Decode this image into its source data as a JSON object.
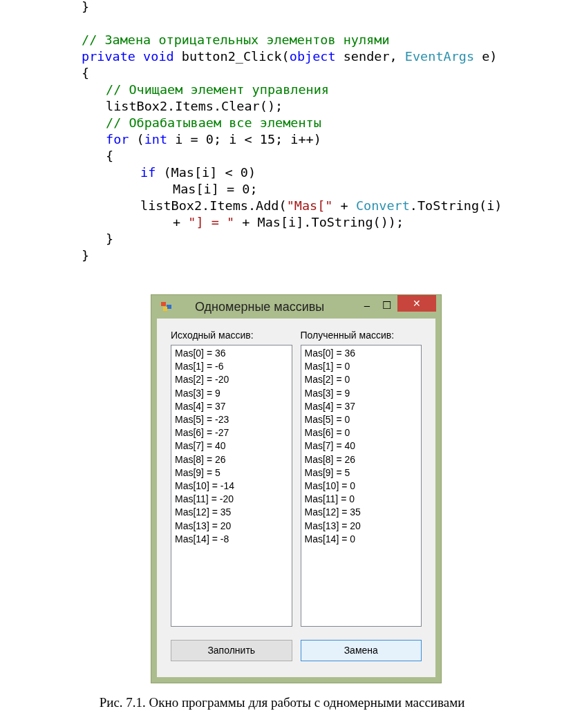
{
  "code": {
    "lines": [
      {
        "kind": "code",
        "tokens": [
          {
            "kind": "plain",
            "text": "}"
          }
        ]
      },
      {
        "kind": "blank"
      },
      {
        "kind": "code",
        "tokens": [
          {
            "kind": "comment",
            "text": "// Замена отрицательных элементов нулями"
          }
        ]
      },
      {
        "kind": "code",
        "tokens": [
          {
            "kind": "keyword",
            "text": "private"
          },
          {
            "kind": "keyword",
            "text": " void"
          },
          {
            "kind": "plain",
            "text": " button2_Click("
          },
          {
            "kind": "keyword",
            "text": "object"
          },
          {
            "kind": "plain",
            "text": " sender, "
          },
          {
            "kind": "type",
            "text": "EventArgs"
          },
          {
            "kind": "plain",
            "text": " e)"
          }
        ]
      },
      {
        "kind": "code",
        "tokens": [
          {
            "kind": "plain",
            "text": "{"
          }
        ],
        "children": [
          {
            "kind": "code",
            "tokens": [
              {
                "kind": "comment",
                "text": "// Очищаем элемент управления"
              }
            ]
          },
          {
            "kind": "code",
            "tokens": [
              {
                "kind": "plain",
                "text": "listBox2.Items.Clear();"
              }
            ]
          },
          {
            "kind": "code",
            "tokens": [
              {
                "kind": "comment",
                "text": "// Обрабатываем все элементы"
              }
            ]
          },
          {
            "kind": "code",
            "tokens": [
              {
                "kind": "keyword",
                "text": "for"
              },
              {
                "kind": "plain",
                "text": " ("
              },
              {
                "kind": "keyword",
                "text": "int"
              },
              {
                "kind": "plain",
                "text": " i = 0; i < 15; i++)"
              }
            ]
          },
          {
            "kind": "code",
            "tokens": [
              {
                "kind": "plain",
                "text": "{"
              }
            ],
            "children": [
              {
                "kind": "code",
                "tokens": [
                  {
                    "kind": "keyword",
                    "text": "if"
                  },
                  {
                    "kind": "plain",
                    "text": " (Mas[i] < 0)"
                  }
                ],
                "children": [
                  {
                    "kind": "code",
                    "tokens": [
                      {
                        "kind": "plain",
                        "text": "Mas[i] = 0;"
                      }
                    ]
                  }
                ]
              },
              {
                "kind": "code",
                "tokens": [
                  {
                    "kind": "plain",
                    "text": "listBox2.Items.Add("
                  },
                  {
                    "kind": "string",
                    "text": "\"Mas[\""
                  },
                  {
                    "kind": "plain",
                    "text": " + "
                  },
                  {
                    "kind": "type",
                    "text": "Convert"
                  },
                  {
                    "kind": "plain",
                    "text": ".ToString(i)"
                  }
                ],
                "children": [
                  {
                    "kind": "code",
                    "tokens": [
                      {
                        "kind": "plain",
                        "text": "+ "
                      },
                      {
                        "kind": "string",
                        "text": "\"] = \""
                      },
                      {
                        "kind": "plain",
                        "text": " + Mas[i].ToString());"
                      }
                    ]
                  }
                ]
              }
            ]
          },
          {
            "kind": "code",
            "tokens": [
              {
                "kind": "plain",
                "text": "}"
              }
            ]
          }
        ]
      },
      {
        "kind": "code",
        "tokens": [
          {
            "kind": "plain",
            "text": "}"
          }
        ]
      }
    ]
  },
  "window": {
    "title": "Одномерные массивы",
    "minimize": "–",
    "maximize": "☐",
    "close": "✕",
    "lists": [
      {
        "label": "Исходный массив:",
        "items": [
          "Mas[0] = 36",
          "Mas[1] = -6",
          "Mas[2] = -20",
          "Mas[3] = 9",
          "Mas[4] = 37",
          "Mas[5] = -23",
          "Mas[6] = -27",
          "Mas[7] = 40",
          "Mas[8] = 26",
          "Mas[9] = 5",
          "Mas[10] = -14",
          "Mas[11] = -20",
          "Mas[12] = 35",
          "Mas[13] = 20",
          "Mas[14] = -8"
        ]
      },
      {
        "label": "Полученный массив:",
        "items": [
          "Mas[0] = 36",
          "Mas[1] = 0",
          "Mas[2] = 0",
          "Mas[3] = 9",
          "Mas[4] = 37",
          "Mas[5] = 0",
          "Mas[6] = 0",
          "Mas[7] = 40",
          "Mas[8] = 26",
          "Mas[9] = 5",
          "Mas[10] = 0",
          "Mas[11] = 0",
          "Mas[12] = 35",
          "Mas[13] = 20",
          "Mas[14] = 0"
        ]
      }
    ],
    "buttons": [
      {
        "label": "Заполнить",
        "focused": false
      },
      {
        "label": "Замена",
        "focused": true
      }
    ]
  },
  "caption": "Рис. 7.1. Окно программы для работы с одномерными массивами"
}
